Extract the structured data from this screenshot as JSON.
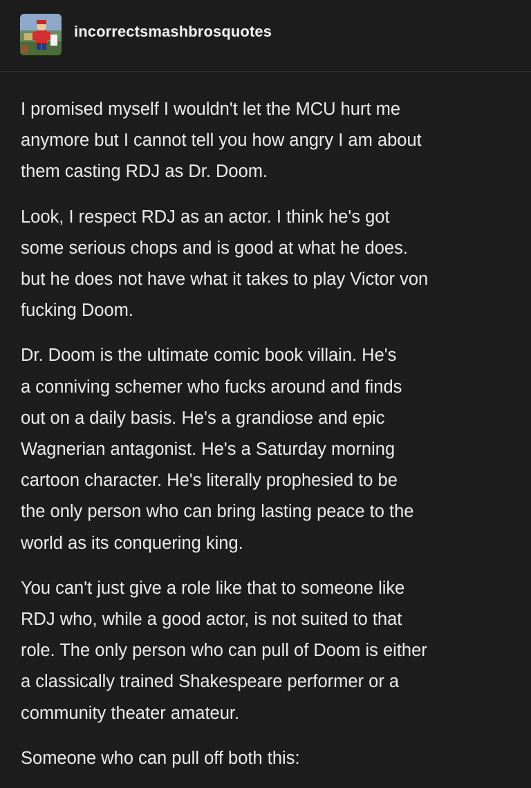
{
  "header": {
    "blog_name": "incorrectsmashbrosquotes",
    "avatar_icon": "blog-avatar-image"
  },
  "post": {
    "paragraphs": [
      {
        "lines": [
          "I promised myself I wouldn't let the MCU hurt me",
          "anymore but I cannot tell you how angry I am about",
          "them casting RDJ as Dr. Doom."
        ]
      },
      {
        "lines": [
          "Look, I respect RDJ as an actor. I think he's got",
          "some serious chops and is good at what he does.",
          "but he does not have what it takes to play Victor von",
          "fucking Doom."
        ]
      },
      {
        "lines": [
          "Dr. Doom is the ultimate comic book villain. He's",
          "a conniving schemer who fucks around and finds",
          "out on a daily basis. He's a grandiose and epic",
          "Wagnerian antagonist. He's a Saturday morning",
          "cartoon character. He's literally prophesied to be",
          "the only person who can bring lasting peace to the",
          "world as its conquering king."
        ]
      },
      {
        "lines": [
          "You can't just give a role like that to someone like",
          "RDJ who, while a good actor, is not suited to that",
          "role. The only person who can pull of Doom is either",
          "a classically trained Shakespeare performer or a",
          "community theater amateur."
        ]
      },
      {
        "lines": [
          "Someone who can pull off both this:"
        ]
      }
    ]
  },
  "colors": {
    "background": "#1d1d1d",
    "text": "#ececec",
    "divider": "#303030"
  }
}
